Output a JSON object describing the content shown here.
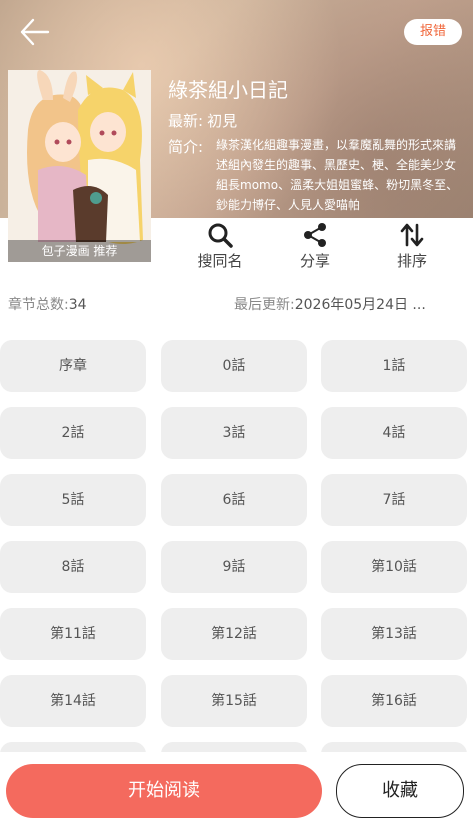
{
  "header": {
    "report_label": "报错",
    "cover_caption": "包子漫画 推荐",
    "title": "綠茶組小日記",
    "latest_label": "最新:",
    "latest_value": "初見",
    "intro_label": "简介:",
    "intro_text": "綠茶漢化組趣事漫畫，以羣魔亂舞的形式來講述組內發生的趣事、黑歷史、梗、全能美少女組長momo、溫柔大姐姐蜜蜂、粉切黑冬至、鈔能力博仔、人見人愛喵帕"
  },
  "actions": [
    {
      "label": "搜同名",
      "icon": "search-icon"
    },
    {
      "label": "分享",
      "icon": "share-icon"
    },
    {
      "label": "排序",
      "icon": "sort-icon"
    }
  ],
  "meta": {
    "count_label": "章节总数:",
    "count_value": "34",
    "updated_label": "最后更新:",
    "updated_value": "2026年05月24日 ..."
  },
  "chapters": [
    "序章",
    "0話",
    "1話",
    "2話",
    "3話",
    "4話",
    "5話",
    "6話",
    "7話",
    "8話",
    "9話",
    "第10話",
    "第11話",
    "第12話",
    "第13話",
    "第14話",
    "第15話",
    "第16話"
  ],
  "bottom": {
    "start_label": "开始阅读",
    "fav_label": "收藏"
  },
  "colors": {
    "accent": "#f46a5e",
    "report": "#f0673b"
  }
}
